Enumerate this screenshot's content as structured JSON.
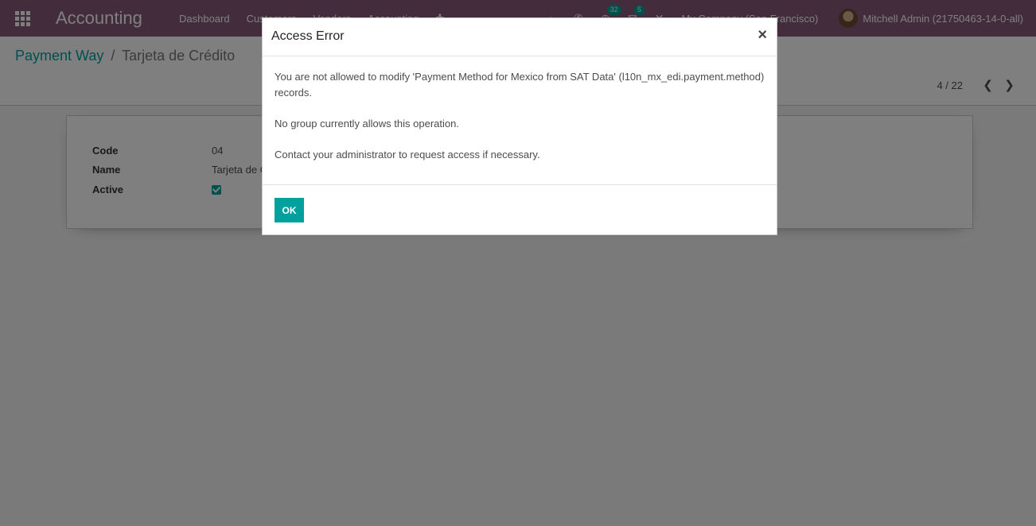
{
  "navbar": {
    "brand": "Accounting",
    "menu": [
      "Dashboard",
      "Customers",
      "Vendors",
      "Accounting"
    ],
    "activities_count": "32",
    "messages_count": "5",
    "company": "My Company (San Francisco)",
    "user": "Mitchell Admin (21750463-14-0-all)"
  },
  "breadcrumb": {
    "parent": "Payment Way",
    "separator": "/",
    "current": "Tarjeta de Crédito"
  },
  "pager": {
    "value": "4 / 22"
  },
  "form": {
    "code_label": "Code",
    "code_value": "04",
    "name_label": "Name",
    "name_value": "Tarjeta de Crédito",
    "active_label": "Active"
  },
  "dialog": {
    "title": "Access Error",
    "close": "×",
    "message_1": "You are not allowed to modify 'Payment Method for Mexico from SAT Data' (l10n_mx_edi.payment.method) records.",
    "message_2": "No group currently allows this operation.",
    "message_3": "Contact your administrator to request access if necessary.",
    "ok_label": "OK"
  },
  "colors": {
    "navbar": "#875a7b",
    "accent": "#00a09d"
  }
}
